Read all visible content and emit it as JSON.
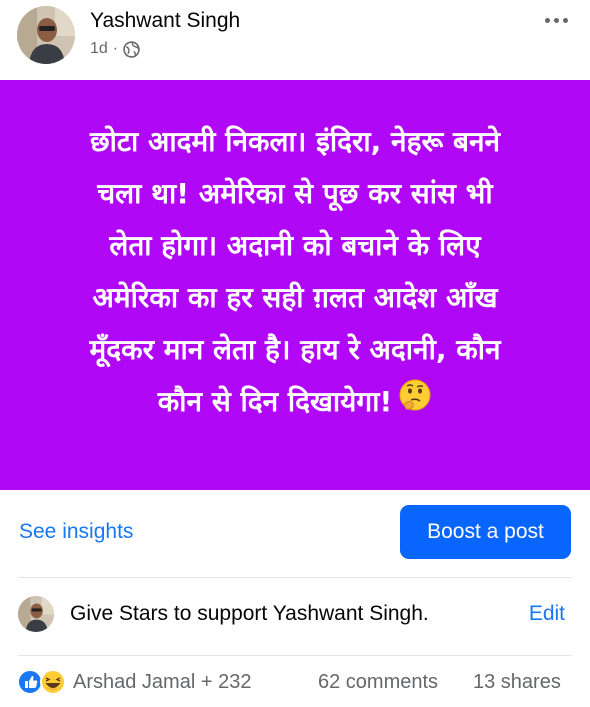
{
  "post": {
    "author": "Yashwant Singh",
    "time": "1d",
    "separator": "·",
    "privacy_icon": "globe-icon",
    "more_icon": "more-horizontal-icon",
    "background_color": "#b008f7",
    "lines": [
      "छोटा आदमी निकला। इंदिरा, नेहरू बनने",
      "चला था! अमेरिका से पूछ कर सांस भी",
      "लेता होगा। अदानी को बचाने के लिए",
      "अमेरिका का हर सही ग़लत आदेश आँख",
      "मूँदकर मान लेता है। हाय रे अदानी, कौन",
      "कौन से दिन दिखायेगा!"
    ],
    "emoji_icon": "thinking-face-icon"
  },
  "actions": {
    "insights_label": "See insights",
    "boost_label": "Boost a post",
    "accent_color": "#1877f2",
    "button_color": "#0866ff"
  },
  "stars": {
    "text": "Give Stars to support Yashwant Singh.",
    "edit_label": "Edit"
  },
  "engagement": {
    "reaction_icons": [
      "like-icon",
      "haha-icon"
    ],
    "reactions_text": "Arshad Jamal + 232",
    "comments": "62 comments",
    "shares": "13 shares"
  }
}
